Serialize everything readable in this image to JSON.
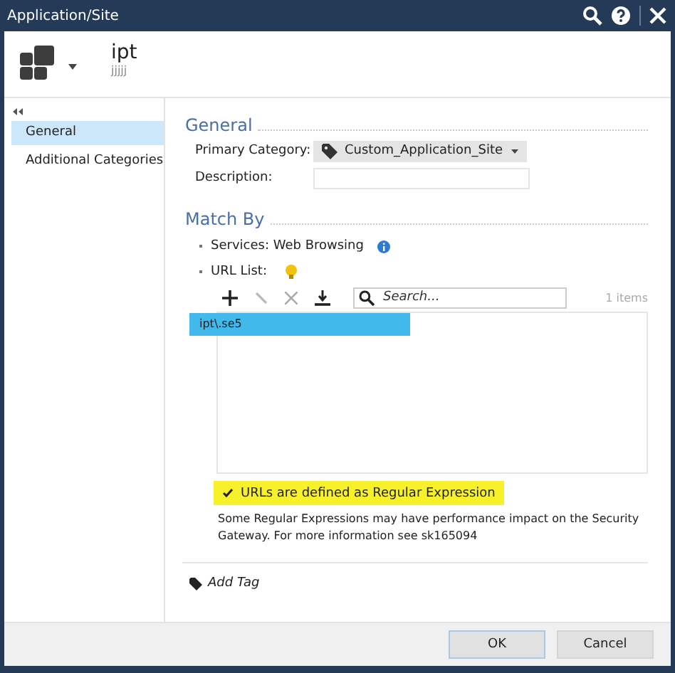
{
  "window": {
    "title": "Application/Site"
  },
  "header": {
    "name": "ipt",
    "subtitle": "jjjjj"
  },
  "sidebar": {
    "items": [
      {
        "label": "General",
        "selected": true
      },
      {
        "label": "Additional Categories",
        "selected": false
      }
    ]
  },
  "general": {
    "heading": "General",
    "fields": [
      {
        "label": "Primary Category:",
        "kind": "dropdown",
        "value": "Custom_Application_Site"
      },
      {
        "label": "Description:",
        "kind": "text"
      }
    ]
  },
  "match_by": {
    "heading": "Match By",
    "services": "Services: Web Browsing",
    "url_list_label": "URL List:",
    "search": {
      "placeholder": "Search..."
    },
    "count": "1 items",
    "rows": [
      {
        "text": "ipt\\.se5",
        "selected": true
      }
    ],
    "regex": {
      "label": "URLs are defined as Regular Expression",
      "checked": true
    },
    "note": "Some Regular Expressions may have performance impact on the Security Gateway. For more information see sk165094"
  },
  "add_tag": "Add Tag",
  "buttons": [
    {
      "label": "OK",
      "kind": "default"
    },
    {
      "label": "Cancel",
      "kind": "normal"
    }
  ]
}
